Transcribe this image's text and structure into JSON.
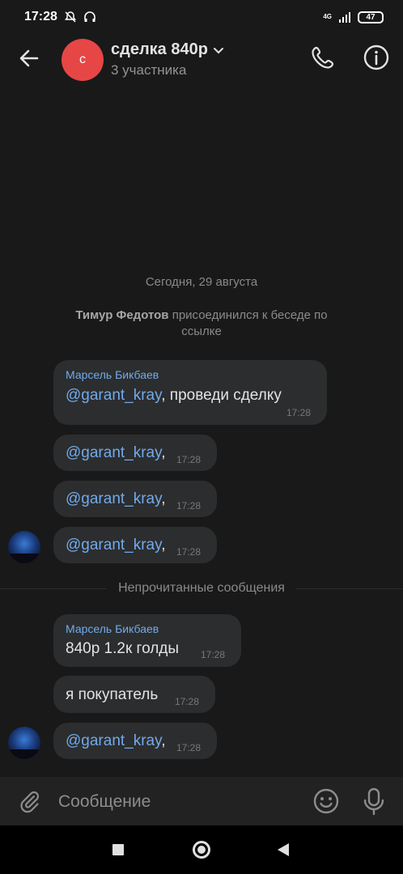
{
  "status_bar": {
    "time": "17:28",
    "network": "4G",
    "battery": "47"
  },
  "header": {
    "avatar_letter": "с",
    "title": "сделка 840р",
    "subtitle": "3 участника"
  },
  "chat": {
    "date_separator": "Сегодня, 29 августа",
    "service_message": {
      "actor": "Тимур Федотов",
      "text": "присоединился к беседе по ссылке"
    },
    "unread_separator": "Непрочитанные сообщения",
    "messages": [
      {
        "author": "Марсель Бикбаев",
        "mention": "@garant_kray",
        "text": ", проведи сделку",
        "time": "17:28"
      },
      {
        "author": "",
        "mention": "@garant_kray",
        "text": ",",
        "time": "17:28"
      },
      {
        "author": "",
        "mention": "@garant_kray",
        "text": ",",
        "time": "17:28"
      },
      {
        "author": "",
        "mention": "@garant_kray",
        "text": ",",
        "time": "17:28"
      },
      {
        "author": "Марсель Бикбаев",
        "mention": "",
        "text": "840р 1.2к голды",
        "time": "17:28"
      },
      {
        "author": "",
        "mention": "",
        "text": "я покупатель",
        "time": "17:28"
      },
      {
        "author": "",
        "mention": "@garant_kray",
        "text": ",",
        "time": "17:28"
      }
    ]
  },
  "composer": {
    "placeholder": "Сообщение"
  },
  "colors": {
    "background": "#191919",
    "bubble": "#2c2d2e",
    "accent": "#71aaeb",
    "avatar": "#e64646"
  },
  "icons": [
    "bell-off-icon",
    "headphones-icon",
    "signal-icon",
    "back-arrow-icon",
    "chevron-down-icon",
    "phone-icon",
    "info-icon",
    "paperclip-icon",
    "emoji-icon",
    "microphone-icon"
  ]
}
